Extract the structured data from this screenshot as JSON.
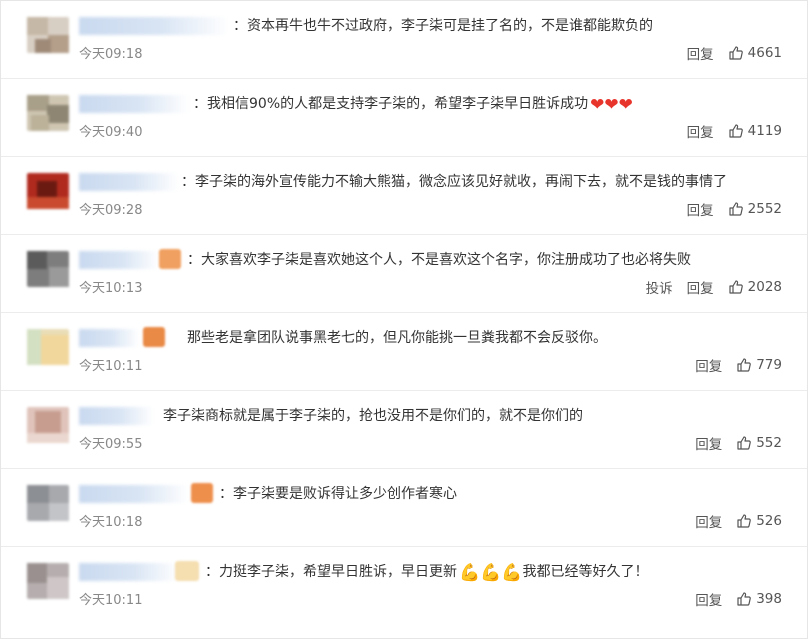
{
  "comments": [
    {
      "text": "：资本再牛也牛不过政府，李子柒可是挂了名的，不是谁都能欺负的",
      "time": "今天09:18",
      "reply_label": "回复",
      "likes": "4661",
      "emoji_icon": "",
      "emoji_count": 0
    },
    {
      "text": "：我相信90%的人都是支持李子柒的，希望李子柒早日胜诉成功",
      "time": "今天09:40",
      "reply_label": "回复",
      "likes": "4119",
      "emoji_icon": "red-heart-icon",
      "emoji_count": 3
    },
    {
      "text": "：李子柒的海外宣传能力不输大熊猫，微念应该见好就收，再闹下去，就不是钱的事情了",
      "time": "今天09:28",
      "reply_label": "回复",
      "likes": "2552",
      "emoji_icon": "",
      "emoji_count": 0
    },
    {
      "text": "：大家喜欢李子柒是喜欢她这个人，不是喜欢这个名字，你注册成功了也必将失败",
      "time": "今天10:13",
      "report_label": "投诉",
      "reply_label": "回复",
      "likes": "2028",
      "emoji_icon": "",
      "emoji_count": 0
    },
    {
      "text": "那些老是拿团队说事黑老七的，但凡你能挑一旦粪我都不会反驳你。",
      "time": "今天10:11",
      "reply_label": "回复",
      "likes": "779",
      "emoji_icon": "",
      "emoji_count": 0
    },
    {
      "text": "李子柒商标就是属于李子柒的，抢也没用不是你们的，就不是你们的",
      "time": "今天09:55",
      "reply_label": "回复",
      "likes": "552",
      "emoji_icon": "",
      "emoji_count": 0
    },
    {
      "text": "：李子柒要是败诉得让多少创作者寒心",
      "time": "今天10:18",
      "reply_label": "回复",
      "likes": "526",
      "emoji_icon": "",
      "emoji_count": 0
    },
    {
      "text": "：力挺李子柒，希望早日胜诉，早日更新",
      "text_after": "我都已经等好久了！",
      "time": "今天10:11",
      "reply_label": "回复",
      "likes": "398",
      "emoji_icon": "flexed-biceps-icon",
      "emoji_count": 3
    }
  ],
  "colors": {
    "text": "#333333",
    "time": "#888888",
    "heart": "#e8352c",
    "name_blur": "#c9d9ef"
  }
}
